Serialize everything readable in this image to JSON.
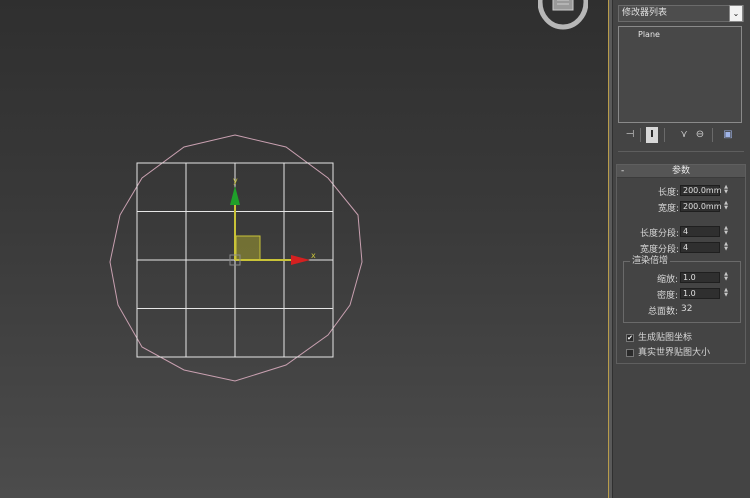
{
  "modifier_panel": {
    "modifier_list_label": "修改器列表",
    "dropdown_arrow": "⌄",
    "stack_items": [
      "Plane"
    ]
  },
  "viewport": {
    "axis_x_label": "x",
    "axis_y_label": "y",
    "grid_segments": 4,
    "colors": {
      "grid": "#e6e6e6",
      "circle": "#c8a0b0",
      "axis_x": "#d42020",
      "axis_y": "#1fa02a",
      "gizmo_plane": "#c9c338"
    }
  },
  "parameters": {
    "rollout_title": "参数",
    "collapse_glyph": "-",
    "length_label": "长度:",
    "length_value": "200.0mm",
    "width_label": "宽度:",
    "width_value": "200.0mm",
    "length_segs_label": "长度分段:",
    "length_segs_value": "4",
    "width_segs_label": "宽度分段:",
    "width_segs_value": "4",
    "render_multipliers_title": "渲染倍增",
    "scale_label": "缩放:",
    "scale_value": "1.0",
    "density_label": "密度:",
    "density_value": "1.0",
    "total_faces_label": "总面数:",
    "total_faces_value": "32",
    "gen_mapping_label": "生成贴图坐标",
    "gen_mapping_checked": true,
    "real_world_label": "真实世界贴图大小",
    "real_world_checked": false,
    "checkmark": "✔"
  }
}
